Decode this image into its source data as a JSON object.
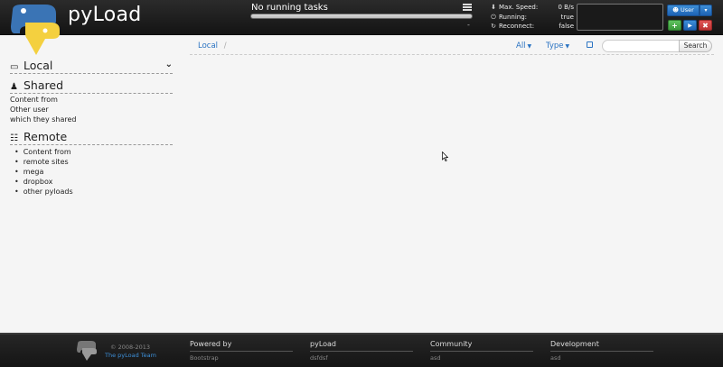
{
  "header": {
    "app_title": "pyLoad",
    "tasks_status": "No running tasks",
    "progress": 0,
    "status_dash": "-",
    "stats": [
      {
        "icon": "download-icon",
        "label": "Max. Speed:",
        "value": "0 B/s"
      },
      {
        "icon": "power-icon",
        "label": "Running:",
        "value": "true"
      },
      {
        "icon": "refresh-icon",
        "label": "Reconnect:",
        "value": "false"
      }
    ],
    "user_label": "User",
    "controls": {
      "add": "+",
      "play": "▶",
      "stop": "✖"
    }
  },
  "toolbar": {
    "breadcrumb_root": "Local",
    "breadcrumb_sep": "/",
    "filter_all": "All",
    "filter_type": "Type",
    "search_placeholder": "",
    "search_button": "Search"
  },
  "sidebar": {
    "local": {
      "title": "Local"
    },
    "shared": {
      "title": "Shared",
      "desc": [
        "Content from",
        "Other user",
        "which they shared"
      ]
    },
    "remote": {
      "title": "Remote",
      "items": [
        "Content from",
        "remote sites",
        "mega",
        "dropbox",
        "other pyloads"
      ]
    }
  },
  "footer": {
    "copyright": "© 2008-2013",
    "team": "The pyLoad Team",
    "columns": [
      {
        "title": "Powered by",
        "value": "Bootstrap"
      },
      {
        "title": "pyLoad",
        "value": "dsfdsf"
      },
      {
        "title": "Community",
        "value": "asd"
      },
      {
        "title": "Development",
        "value": "asd"
      }
    ]
  },
  "colors": {
    "accent": "#2a73c2",
    "header_bg": "#1e1e1e",
    "logo_blue": "#3a74b5",
    "logo_yellow": "#f4d03f"
  }
}
